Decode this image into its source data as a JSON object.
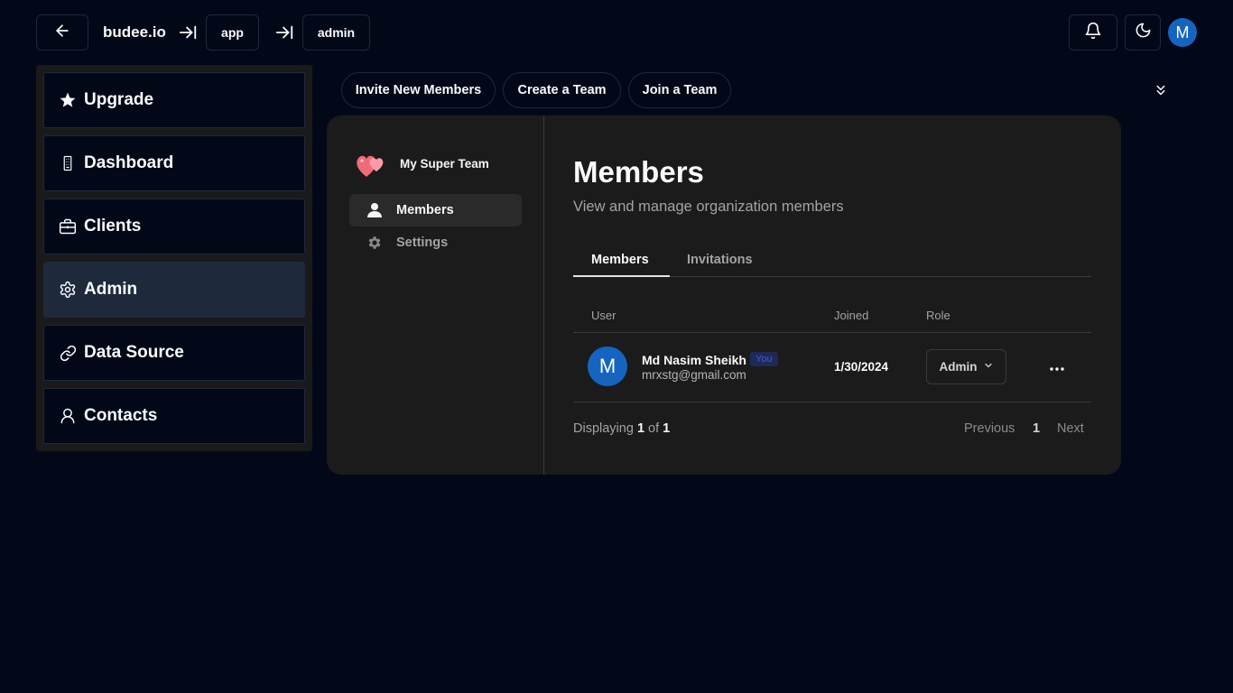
{
  "header": {
    "brand": "budee.io",
    "breadcrumbs": [
      "app",
      "admin"
    ],
    "avatar_initial": "M",
    "icons": {
      "back": "arrow-left-icon",
      "separator": "arrow-right-to-line-icon",
      "notifications": "bell-icon",
      "theme": "moon-icon"
    }
  },
  "sidebar": {
    "items": [
      {
        "label": "Upgrade",
        "icon": "star-icon"
      },
      {
        "label": "Dashboard",
        "icon": "building-icon"
      },
      {
        "label": "Clients",
        "icon": "briefcase-icon"
      },
      {
        "label": "Admin",
        "icon": "gear-icon",
        "active": true
      },
      {
        "label": "Data Source",
        "icon": "link-icon"
      },
      {
        "label": "Contacts",
        "icon": "user-icon"
      }
    ]
  },
  "actions": {
    "invite": "Invite New Members",
    "create_team": "Create a Team",
    "join_team": "Join a Team",
    "collapse_icon": "chevrons-down-icon"
  },
  "org_nav": {
    "team_name": "My Super Team",
    "team_icon": "hearts-icon",
    "items": [
      {
        "label": "Members",
        "icon": "person-icon",
        "active": true
      },
      {
        "label": "Settings",
        "icon": "cog-icon"
      }
    ]
  },
  "members_panel": {
    "title": "Members",
    "subtitle": "View and manage organization members",
    "tabs": [
      "Members",
      "Invitations"
    ],
    "columns": [
      "User",
      "Joined",
      "Role"
    ],
    "rows": [
      {
        "avatar_initial": "M",
        "name": "Md Nasim Sheikh",
        "badge": "You",
        "email": "mrxstg@gmail.com",
        "joined": "1/30/2024",
        "role": "Admin"
      }
    ],
    "pagination": {
      "prefix": "Displaying",
      "current": "1",
      "of": "of",
      "total": "1",
      "previous": "Previous",
      "page": "1",
      "next": "Next"
    }
  },
  "colors": {
    "background": "#020817",
    "card": "#1b1b1b",
    "avatar": "#1565c0",
    "badge_bg": "#1e2a55",
    "badge_text": "#3b5bdb"
  }
}
